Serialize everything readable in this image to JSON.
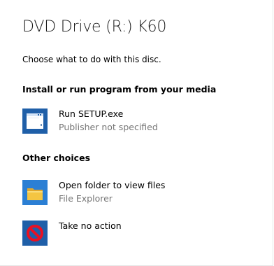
{
  "window": {
    "title": "DVD Drive (R:) K60",
    "prompt": "Choose what to do with this disc."
  },
  "sections": {
    "install": {
      "heading": "Install or run program from your media",
      "options": [
        {
          "label": "Run SETUP.exe",
          "sublabel": "Publisher not specified",
          "icon": "setup-window-icon"
        }
      ]
    },
    "other": {
      "heading": "Other choices",
      "options": [
        {
          "label": "Open folder to view files",
          "sublabel": "File Explorer",
          "icon": "folder-icon"
        },
        {
          "label": "Take no action",
          "sublabel": "",
          "icon": "no-action-icon"
        }
      ]
    }
  },
  "colors": {
    "setup_icon_blue": "#1f5fa8",
    "folder_yellow": "#f4c542",
    "folder_tile": "#2b7fd4",
    "no_action_tile": "#1f5fa8",
    "no_action_red": "#e81123",
    "secondary_text": "#767676"
  }
}
